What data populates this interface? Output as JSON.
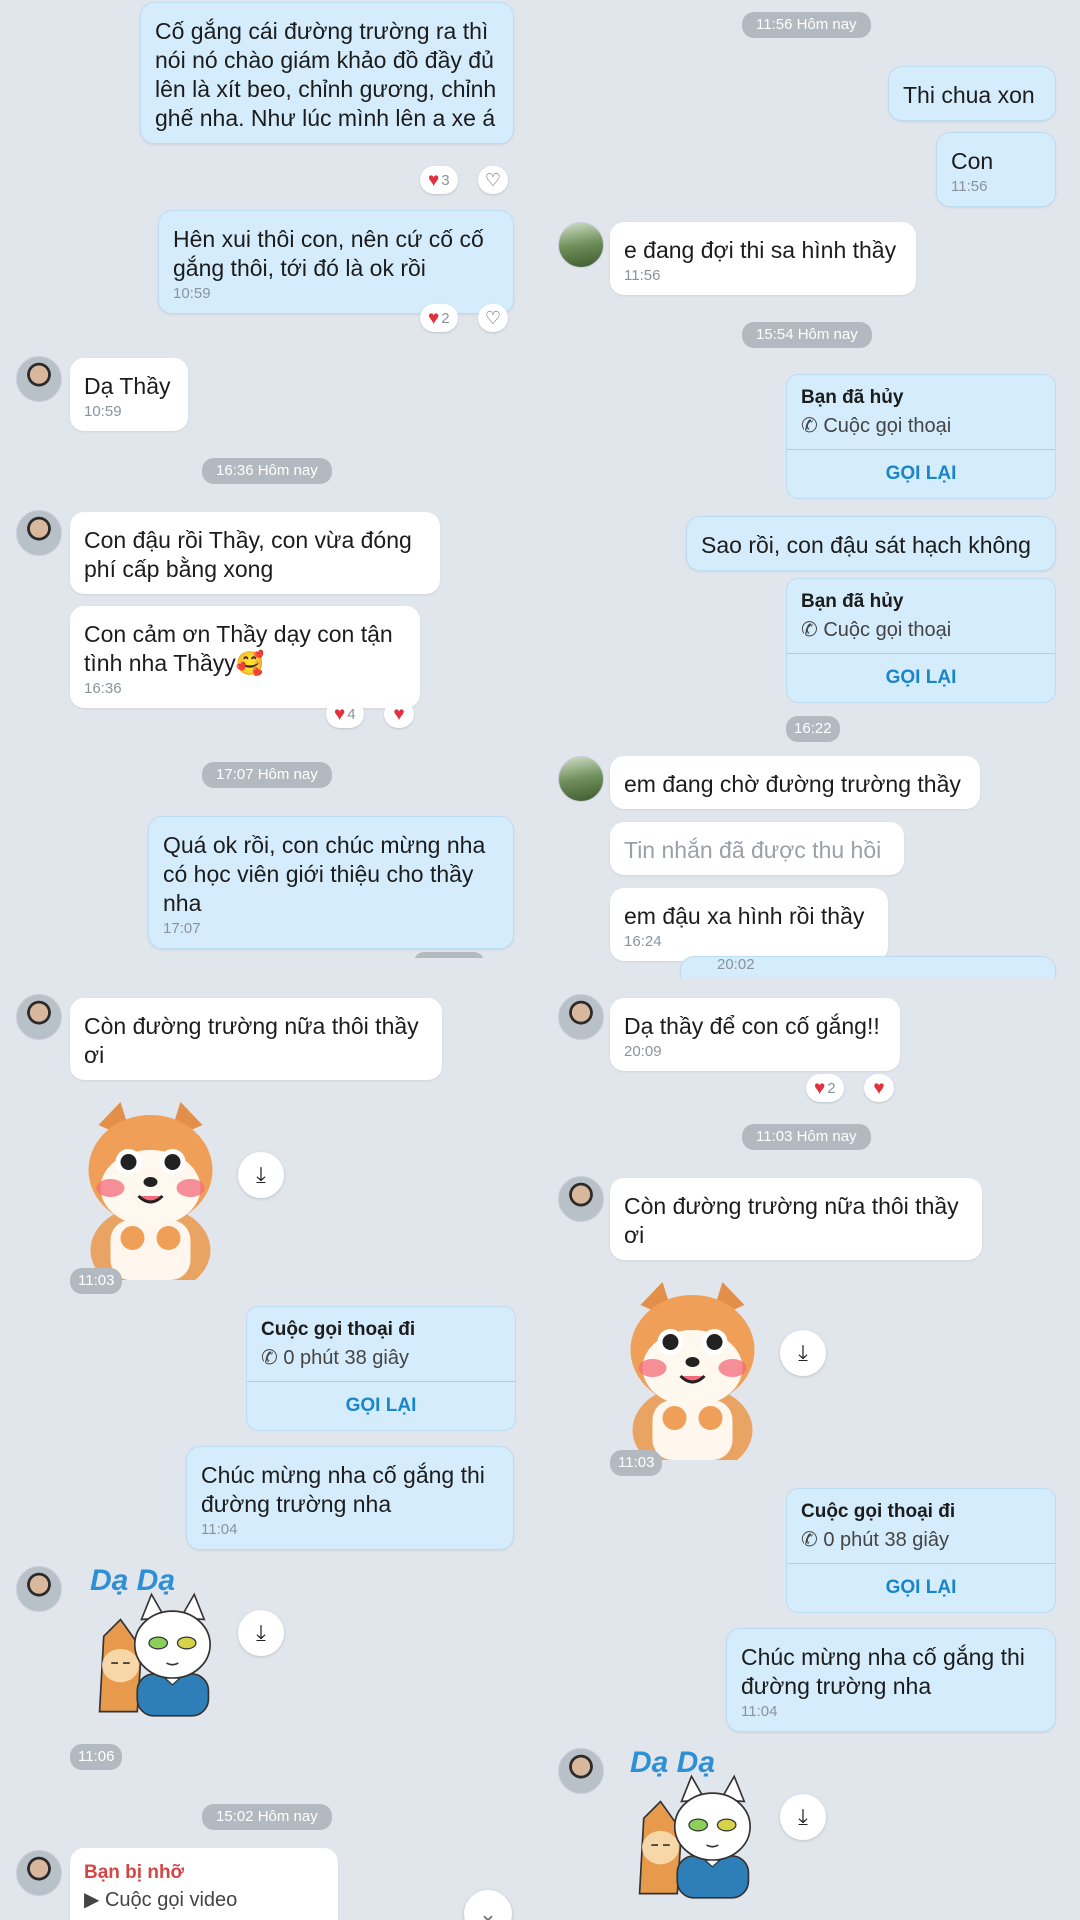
{
  "top_left": {
    "msg1": "Cố gắng cái đường trường ra thì nói nó chào giám khảo đồ đầy đủ lên là xít beo, chỉnh gương, chỉnh ghế nha. Như lúc mình lên a xe á",
    "react1_count": "3",
    "msg2": "Hên xui thôi con, nên cứ cố cố gắng thôi, tới đó là ok rồi",
    "msg2_time": "10:59",
    "react2_count": "2",
    "msg3": "Dạ Thầy",
    "msg3_time": "10:59",
    "sep1": "16:36 Hôm nay",
    "msg4": "Con đậu rồi Thầy, con vừa đóng phí cấp bằng xong",
    "msg5": "Con cảm ơn Thầy dạy con tận tình nha Thầyy🥰",
    "msg5_time": "16:36",
    "react5_count": "4",
    "sep2": "17:07 Hôm nay",
    "msg6": "Quá ok rồi, con chúc mừng nha có học viên giới thiệu cho thầy nha",
    "msg6_time": "17:07"
  },
  "top_right": {
    "sep1": "11:56 Hôm nay",
    "msg1": "Thi chua xon",
    "msg2": "Con",
    "msg2_time": "11:56",
    "msg3": "e đang đợi thi sa hình thầy",
    "msg3_time": "11:56",
    "sep2": "15:54 Hôm nay",
    "call1_title": "Bạn đã hủy",
    "call1_sub": "Cuộc gọi thoại",
    "call1_btn": "GỌI LẠI",
    "msg4": "Sao rồi, con đậu sát hạch không",
    "call2_title": "Bạn đã hủy",
    "call2_sub": "Cuộc gọi thoại",
    "call2_btn": "GỌI LẠI",
    "time_pill": "16:22",
    "msg5": "em đang chờ đường trường thầy",
    "msg6": "Tin nhắn đã được thu hồi",
    "msg7": "em đậu xa hình rồi thầy",
    "msg7_time": "16:24",
    "partial_time": "20:02"
  },
  "bottom_left": {
    "msg1": "Còn đường trường nữa thôi thầy ơi",
    "sticker1_time": "11:03",
    "call_title": "Cuộc gọi thoại đi",
    "call_sub": "0 phút 38 giây",
    "call_btn": "GỌI LẠI",
    "msg2": "Chúc mừng nha cố gắng thi đường trường nha",
    "msg2_time": "11:04",
    "sticker2_text": "Dạ Dạ",
    "sticker2_time": "11:06",
    "sep1": "15:02 Hôm nay",
    "missed_title": "Bạn bị nhỡ",
    "missed_sub": "Cuộc gọi video"
  },
  "bottom_right": {
    "msg1": "Dạ thầy để con cố gắng!!",
    "msg1_time": "20:09",
    "react1_count": "2",
    "sep1": "11:03 Hôm nay",
    "msg2": "Còn đường trường nữa thôi thầy ơi",
    "sticker1_time": "11:03",
    "call_title": "Cuộc gọi thoại đi",
    "call_sub": "0 phút 38 giây",
    "call_btn": "GỌI LẠI",
    "msg3": "Chúc mừng nha cố gắng thi đường trường nha",
    "msg3_time": "11:04",
    "sticker2_text": "Dạ Dạ"
  },
  "icons": {
    "heart": "♥",
    "heart_outline": "♡",
    "download": "⤓",
    "phone": "✆",
    "video": "▶",
    "chevron": "⌄"
  },
  "colors": {
    "background": "#e1e6ec",
    "my_bubble": "#d4ecfc",
    "their_bubble": "#ffffff",
    "accent": "#1a86c8",
    "missed": "#d64545",
    "heart": "#e0313f"
  }
}
